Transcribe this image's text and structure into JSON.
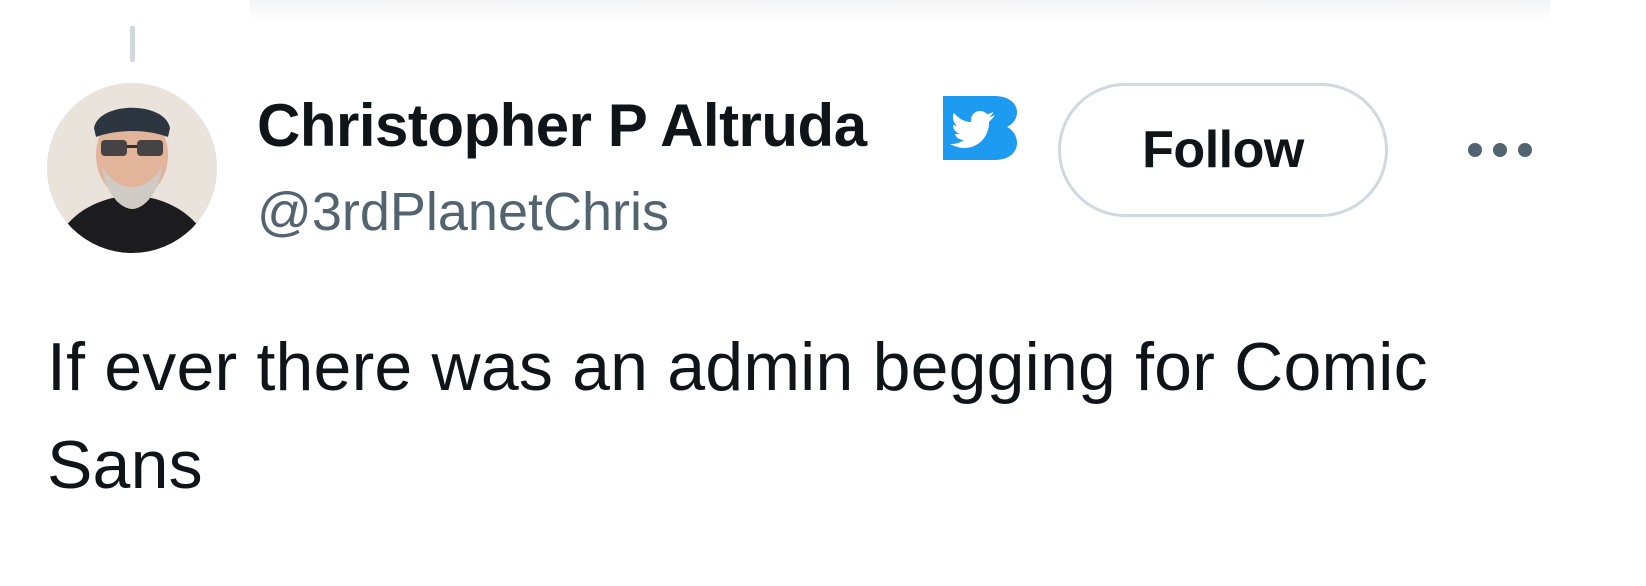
{
  "tweet": {
    "author": {
      "display_name": "Christopher P Altruda",
      "handle": "@3rdPlanetChris",
      "verified_icon": "twitter-bird-badge-icon"
    },
    "follow_button": {
      "label": "Follow"
    },
    "more_icon": "more-horizontal-icon",
    "text": "If ever there was an admin begging for Comic\nSans"
  },
  "colors": {
    "primary_text": "#0f1419",
    "secondary_text": "#536471",
    "border": "#cfd9de",
    "verified_blue": "#1d9bf0"
  }
}
